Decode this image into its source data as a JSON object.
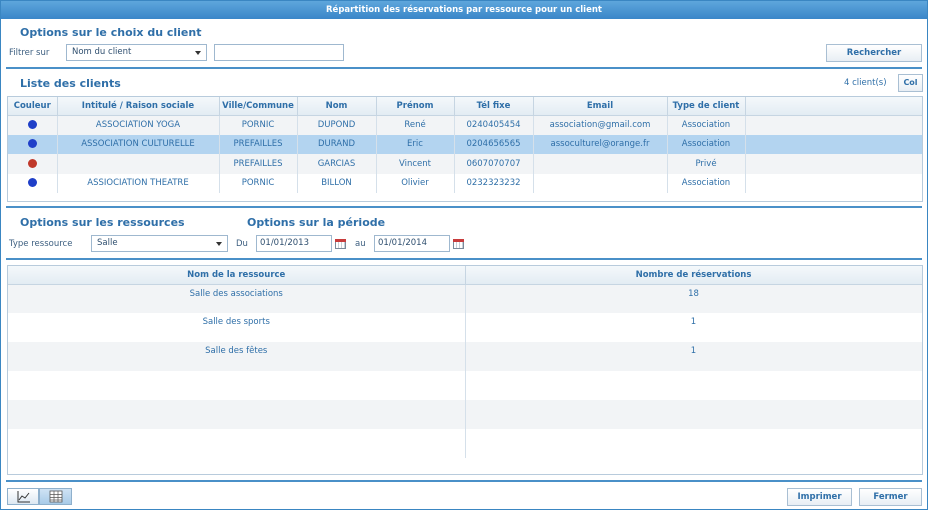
{
  "window": {
    "title": "Répartition des réservations par ressource pour un client"
  },
  "client_options": {
    "title": "Options sur le choix du client",
    "filter_label": "Filtrer sur",
    "filter_select": "Nom du client",
    "filter_value": "",
    "search_button": "Rechercher"
  },
  "clients": {
    "title": "Liste des clients",
    "count": "4 client(s)",
    "col_button": "Col",
    "columns": [
      "Couleur",
      "Intitulé / Raison sociale",
      "Ville/Commune",
      "Nom",
      "Prénom",
      "Tél fixe",
      "Email",
      "Type de client"
    ],
    "rows": [
      {
        "color": "#1f3fc8",
        "raison": "ASSOCIATION YOGA",
        "ville": "PORNIC",
        "nom": "DUPOND",
        "prenom": "René",
        "tel": "0240405454",
        "email": "association@gmail.com",
        "type": "Association"
      },
      {
        "color": "#1f3fc8",
        "raison": "ASSOCIATION CULTURELLE",
        "ville": "PREFAILLES",
        "nom": "DURAND",
        "prenom": "Eric",
        "tel": "0204656565",
        "email": "assoculturel@orange.fr",
        "type": "Association"
      },
      {
        "color": "#c0392b",
        "raison": "",
        "ville": "PREFAILLES",
        "nom": "GARCIAS",
        "prenom": "Vincent",
        "tel": "0607070707",
        "email": "",
        "type": "Privé"
      },
      {
        "color": "#1f3fc8",
        "raison": "ASSIOCIATION THEATRE",
        "ville": "PORNIC",
        "nom": "BILLON",
        "prenom": "Olivier",
        "tel": "0232323232",
        "email": "",
        "type": "Association"
      }
    ]
  },
  "resource_options": {
    "title": "Options sur les ressources",
    "type_label": "Type ressource",
    "type_select": "Salle"
  },
  "period_options": {
    "title": "Options sur la période",
    "du_label": "Du",
    "du_value": "01/01/2013",
    "au_label": "au",
    "au_value": "01/01/2014"
  },
  "resources": {
    "columns": [
      "Nom de la ressource",
      "Nombre de réservations"
    ],
    "rows": [
      {
        "name": "Salle des associations",
        "count": "18"
      },
      {
        "name": "Salle des sports",
        "count": "1"
      },
      {
        "name": "Salle des fêtes",
        "count": "1"
      }
    ]
  },
  "footer": {
    "print_button": "Imprimer",
    "close_button": "Fermer",
    "toggle_chart_icon": "chart-icon",
    "toggle_table_icon": "table-icon"
  }
}
